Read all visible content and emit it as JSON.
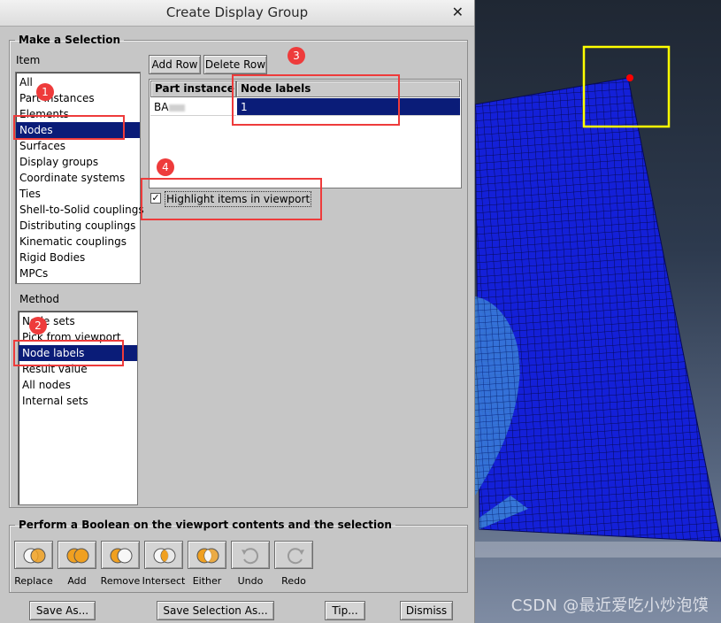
{
  "dialog": {
    "title": "Create Display Group",
    "close_icon": "close-icon",
    "selection_group": "Make a Selection",
    "item_label": "Item",
    "items": [
      "All",
      "Part instances",
      "Elements",
      "Nodes",
      "Surfaces",
      "Display groups",
      "Coordinate systems",
      "Ties",
      "Shell-to-Solid couplings",
      "Distributing couplings",
      "Kinematic couplings",
      "Rigid Bodies",
      "MPCs"
    ],
    "items_selected": "Nodes",
    "method_label": "Method",
    "methods": [
      "Node sets",
      "Pick from viewport",
      "Node labels",
      "Result value",
      "All nodes",
      "Internal sets"
    ],
    "methods_selected": "Node labels",
    "add_row": "Add Row",
    "delete_row": "Delete Row",
    "table": {
      "headers": [
        "Part instance",
        "Node labels"
      ],
      "rows": [
        [
          "BA",
          "1"
        ]
      ]
    },
    "highlight_label": "Highlight items in viewport",
    "highlight_checked": true,
    "boolean_group": "Perform a Boolean on the viewport contents and the selection",
    "boolean_buttons": [
      {
        "label": "Replace",
        "icon": "replace-icon"
      },
      {
        "label": "Add",
        "icon": "add-icon"
      },
      {
        "label": "Remove",
        "icon": "remove-icon"
      },
      {
        "label": "Intersect",
        "icon": "intersect-icon"
      },
      {
        "label": "Either",
        "icon": "either-icon"
      },
      {
        "label": "Undo",
        "icon": "undo-icon"
      },
      {
        "label": "Redo",
        "icon": "redo-icon"
      }
    ],
    "bottom_buttons": {
      "save_as": "Save As...",
      "save_selection_as": "Save Selection As...",
      "tip": "Tip...",
      "dismiss": "Dismiss"
    }
  },
  "annotations": [
    "1",
    "2",
    "3",
    "4"
  ],
  "colors": {
    "mesh": "#1420d8",
    "selection": "#0a1c78",
    "annotation": "#ee3b3b",
    "highlight_box": "#ffff00",
    "node_marker": "#ff0000"
  },
  "watermark": "CSDN @最近爱吃小炒泡馍"
}
